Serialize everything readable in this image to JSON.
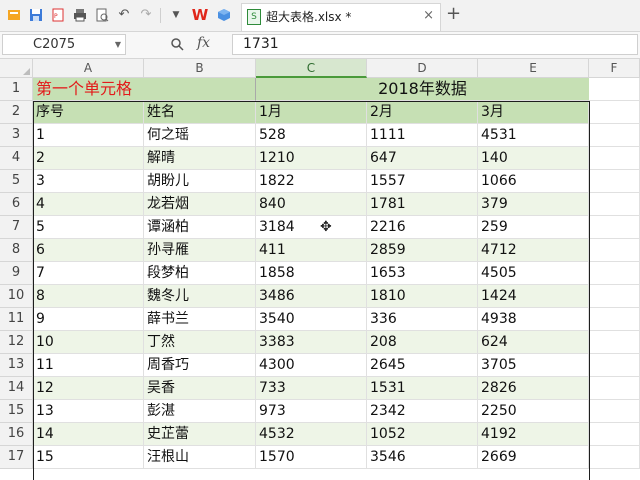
{
  "tab": {
    "title": "超大表格.xlsx *"
  },
  "formula_bar": {
    "cell_ref": "C2075",
    "fx_label": "fx",
    "value": "1731"
  },
  "columns": [
    "A",
    "B",
    "C",
    "D",
    "E",
    "F"
  ],
  "active_column": "C",
  "sheet": {
    "title_left": "第一个单元格",
    "title_right": "2018年数据",
    "headers": [
      "序号",
      "姓名",
      "1月",
      "2月",
      "3月"
    ],
    "rows": [
      [
        "1",
        "何之瑶",
        "528",
        "1111",
        "4531"
      ],
      [
        "2",
        "解晴",
        "1210",
        "647",
        "140"
      ],
      [
        "3",
        "胡盼儿",
        "1822",
        "1557",
        "1066"
      ],
      [
        "4",
        "龙若烟",
        "840",
        "1781",
        "379"
      ],
      [
        "5",
        "谭涵柏",
        "3184",
        "2216",
        "259"
      ],
      [
        "6",
        "孙寻雁",
        "411",
        "2859",
        "4712"
      ],
      [
        "7",
        "段梦柏",
        "1858",
        "1653",
        "4505"
      ],
      [
        "8",
        "魏冬儿",
        "3486",
        "1810",
        "1424"
      ],
      [
        "9",
        "薛书兰",
        "3540",
        "336",
        "4938"
      ],
      [
        "10",
        "丁然",
        "3383",
        "208",
        "624"
      ],
      [
        "11",
        "周香巧",
        "4300",
        "2645",
        "3705"
      ],
      [
        "12",
        "吴香",
        "733",
        "1531",
        "2826"
      ],
      [
        "13",
        "彭湛",
        "973",
        "2342",
        "2250"
      ],
      [
        "14",
        "史芷蕾",
        "4532",
        "1052",
        "4192"
      ],
      [
        "15",
        "汪根山",
        "1570",
        "3546",
        "2669"
      ]
    ],
    "row_numbers": [
      "1",
      "2",
      "3",
      "4",
      "5",
      "6",
      "7",
      "8",
      "9",
      "10",
      "11",
      "12",
      "13",
      "14",
      "15",
      "16",
      "17"
    ]
  },
  "colors": {
    "header_green": "#c6e0b4",
    "band_green": "#eef5e7",
    "title_red": "#e31a1a"
  },
  "icons": [
    "save-icon",
    "pdf-icon",
    "print-icon",
    "preview-icon",
    "undo-icon",
    "redo-icon",
    "dropdown-icon",
    "wps-logo-icon",
    "cube-icon",
    "spreadsheet-icon",
    "close-icon",
    "plus-icon",
    "zoom-icon",
    "fx-icon"
  ]
}
